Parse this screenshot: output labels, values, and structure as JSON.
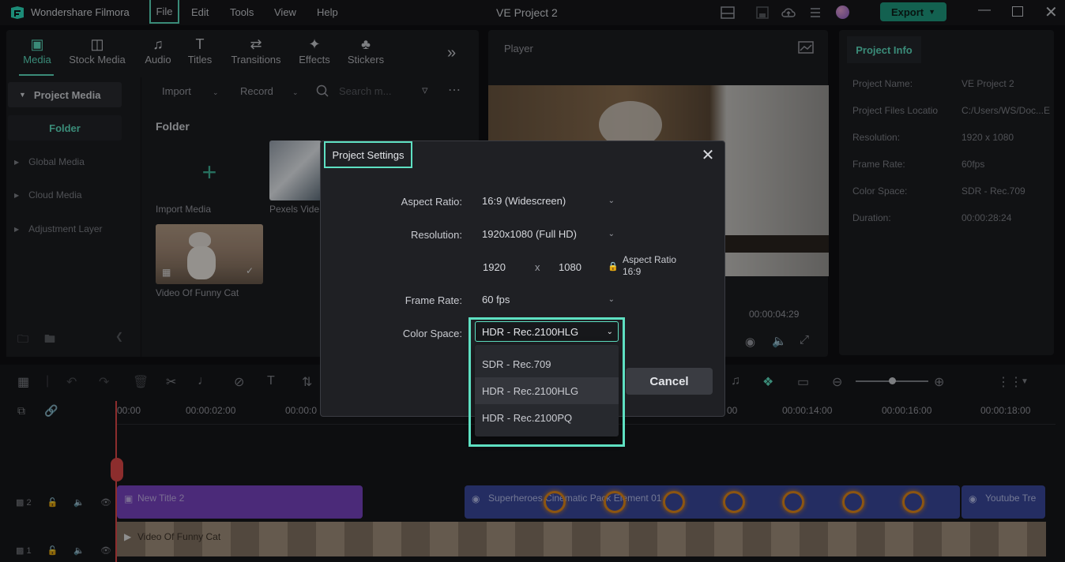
{
  "app": {
    "name": "Wondershare Filmora",
    "project_title": "VE Project 2",
    "export_label": "Export"
  },
  "menu": [
    "File",
    "Edit",
    "Tools",
    "View",
    "Help"
  ],
  "media_tabs": [
    {
      "label": "Media",
      "icon": "media-icon"
    },
    {
      "label": "Stock Media",
      "icon": "stock-media-icon"
    },
    {
      "label": "Audio",
      "icon": "music-note-icon"
    },
    {
      "label": "Titles",
      "icon": "text-t-icon"
    },
    {
      "label": "Transitions",
      "icon": "transitions-icon"
    },
    {
      "label": "Effects",
      "icon": "sparkle-icon"
    },
    {
      "label": "Stickers",
      "icon": "stickers-icon"
    }
  ],
  "sidebar": {
    "project_media": "Project Media",
    "folder": "Folder",
    "items": [
      "Global Media",
      "Cloud Media",
      "Adjustment Layer"
    ]
  },
  "media_toolbar": {
    "import": "Import",
    "record": "Record",
    "search_placeholder": "Search m..."
  },
  "content": {
    "folder_title": "Folder",
    "import_label": "Import Media",
    "pexels_label": "Pexels Vide",
    "cat_label": "Video Of Funny Cat"
  },
  "player": {
    "label": "Player",
    "time": "00:00:04:29"
  },
  "project_info": {
    "tab": "Project Info",
    "rows": [
      {
        "key": "Project Name:",
        "value": "VE Project 2"
      },
      {
        "key": "Project Files Locatio",
        "value": "C:/Users/WS/Doc...E"
      },
      {
        "key": "Resolution:",
        "value": "1920 x 1080"
      },
      {
        "key": "Frame Rate:",
        "value": "60fps"
      },
      {
        "key": "Color Space:",
        "value": "SDR - Rec.709"
      },
      {
        "key": "Duration:",
        "value": "00:00:28:24"
      }
    ]
  },
  "timeline": {
    "ticks": [
      "00:00",
      "00:00:02:00",
      "00:00:0",
      "00",
      "00:00:14:00",
      "00:00:16:00",
      "00:00:18:00"
    ],
    "tracks": [
      {
        "label": "2"
      },
      {
        "label": "1"
      }
    ],
    "clips": {
      "title": "New Title 2",
      "superheroes": "Superheroes Cinematic Pack Element 01",
      "youtube": "Youtube Tre",
      "video": "Video Of Funny Cat"
    }
  },
  "dialog": {
    "title": "Project Settings",
    "aspect_ratio_label": "Aspect Ratio:",
    "aspect_ratio_value": "16:9 (Widescreen)",
    "resolution_label": "Resolution:",
    "resolution_value": "1920x1080 (Full HD)",
    "width": "1920",
    "x": "x",
    "height": "1080",
    "aspect_lock_label": "Aspect Ratio 16:9",
    "frame_rate_label": "Frame Rate:",
    "frame_rate_value": "60 fps",
    "color_space_label": "Color Space:",
    "color_space_value": "HDR - Rec.2100HLG",
    "color_space_options": [
      "SDR - Rec.709",
      "HDR - Rec.2100HLG",
      "HDR - Rec.2100PQ"
    ],
    "selected_option": 1,
    "cancel": "Cancel"
  },
  "colors": {
    "accent": "#5ee0c2",
    "export": "#1f9d82",
    "title_clip": "#7a45c4",
    "effect_clip": "#3b4a9e",
    "playhead": "#e24a4a"
  }
}
